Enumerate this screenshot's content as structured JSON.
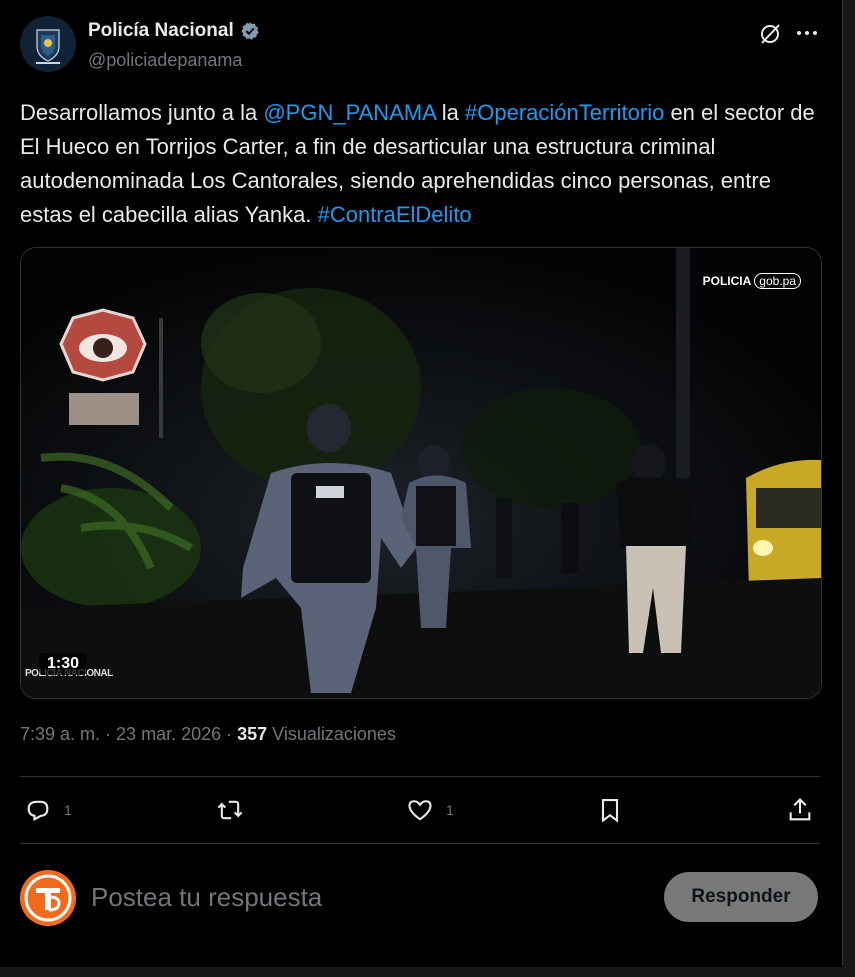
{
  "author": {
    "display_name": "Policía Nacional",
    "handle": "@policiadepanama",
    "verified_icon": "verified-badge-icon",
    "avatar_text": "POLICÍA NACIONAL"
  },
  "header_actions": {
    "grok_icon": "grok-icon",
    "more_icon": "more-options-icon"
  },
  "tweet": {
    "segments": [
      {
        "text": "Desarrollamos junto a la ",
        "link": false
      },
      {
        "text": "@PGN_PANAMA",
        "link": true
      },
      {
        "text": " la ",
        "link": false
      },
      {
        "text": "#OperaciónTerritorio",
        "link": true
      },
      {
        "text": " en el sector de El Hueco en Torrijos Carter, a fin de desarticular una estructura criminal autodenominada Los Cantorales, siendo aprehendidas cinco personas, entre estas el cabecilla alias Yanka. ",
        "link": false
      },
      {
        "text": "#ContraElDelito",
        "link": true
      }
    ]
  },
  "media": {
    "duration": "1:30",
    "brand": "POLICIA",
    "brand_domain": "gob.pa",
    "lower_logo": "POLICIA NACIONAL"
  },
  "meta": {
    "time": "7:39 a. m.",
    "separator": " · ",
    "date": "23 mar. 2026",
    "views_count": "357",
    "views_label": " Visualizaciones"
  },
  "actions": {
    "reply_count": "1",
    "repost_count": "",
    "like_count": "1"
  },
  "reply_box": {
    "placeholder": "Postea tu respuesta",
    "button_label": "Responder",
    "avatar_text": "TD"
  },
  "colors": {
    "background": "#000000",
    "text": "#e7e9ea",
    "muted": "#71767b",
    "link": "#1d9bf0",
    "verified": "#829aab",
    "reply_button": "#787a7a"
  }
}
